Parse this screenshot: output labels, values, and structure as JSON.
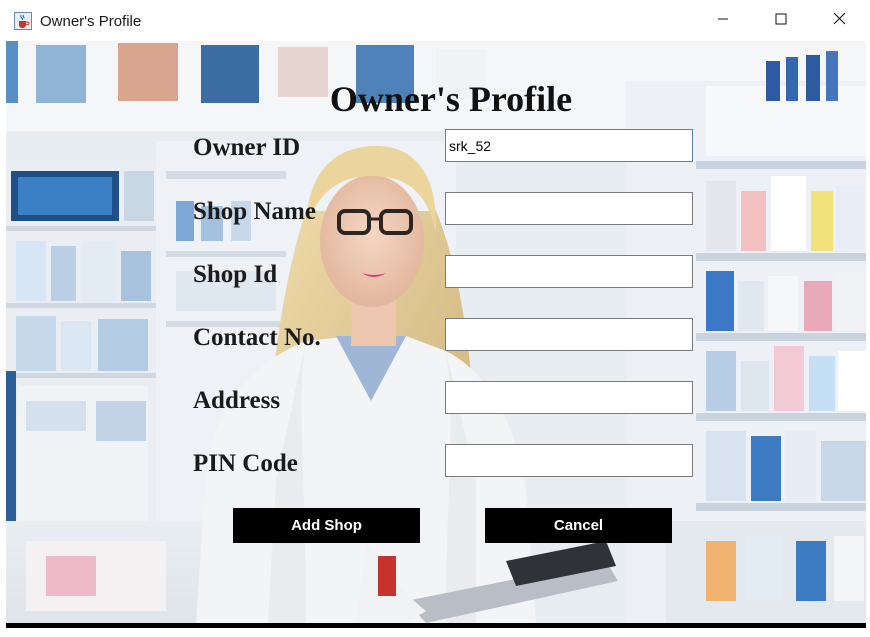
{
  "window": {
    "title": "Owner's Profile",
    "icon": "java-cup-icon",
    "controls": [
      "minimize-icon",
      "maximize-icon",
      "close-icon"
    ]
  },
  "form": {
    "heading": "Owner's Profile",
    "fields": [
      {
        "label": "Owner ID",
        "value": "srk_52"
      },
      {
        "label": "Shop Name",
        "value": ""
      },
      {
        "label": "Shop Id",
        "value": ""
      },
      {
        "label": "Contact No.",
        "value": ""
      },
      {
        "label": "Address",
        "value": ""
      },
      {
        "label": "PIN Code",
        "value": ""
      }
    ],
    "buttons": {
      "add_shop": "Add Shop",
      "cancel": "Cancel"
    }
  },
  "background": {
    "description_icon": "pharmacist-photo",
    "colors": {
      "shelf_blue": "#3c7fc8",
      "coat_white": "#f2f3f5",
      "hair_blonde": "#e3cf9f"
    }
  }
}
